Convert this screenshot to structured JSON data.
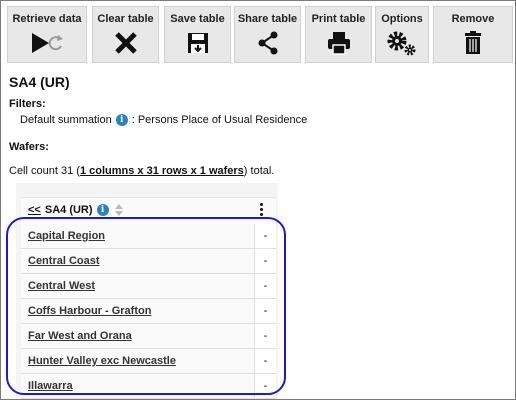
{
  "toolbar": {
    "buttons": [
      {
        "label": "Retrieve data",
        "icon": "play-refresh-icon"
      },
      {
        "label": "Clear table",
        "icon": "x-icon"
      },
      {
        "label": "Save table",
        "icon": "save-icon"
      },
      {
        "label": "Share table",
        "icon": "share-icon"
      },
      {
        "label": "Print table",
        "icon": "printer-icon"
      },
      {
        "label": "Options",
        "icon": "gears-icon"
      },
      {
        "label": "Remove",
        "icon": "trash-icon"
      }
    ]
  },
  "page": {
    "title": "SA4 (UR)",
    "filters_heading": "Filters:",
    "filter_label": "Default summation",
    "filter_value": ": Persons Place of Usual Residence",
    "wafers_heading": "Wafers:",
    "cell_count_prefix": "Cell count 31 (",
    "cell_count_link": "1 columns x 31 rows x 1 wafers",
    "cell_count_suffix": ") total."
  },
  "table": {
    "header_back": "<<",
    "header_label": "SA4 (UR)",
    "rows": [
      {
        "name": "Capital Region",
        "value": "-"
      },
      {
        "name": "Central Coast",
        "value": "-"
      },
      {
        "name": "Central West",
        "value": "-"
      },
      {
        "name": "Coffs Harbour - Grafton",
        "value": "-"
      },
      {
        "name": "Far West and Orana",
        "value": "-"
      },
      {
        "name": "Hunter Valley exc Newcastle",
        "value": "-"
      },
      {
        "name": "Illawarra",
        "value": "-"
      }
    ]
  },
  "colors": {
    "highlight": "#1a1adf",
    "info": "#2c7fc1",
    "button_bg": "#e8e8e8"
  }
}
